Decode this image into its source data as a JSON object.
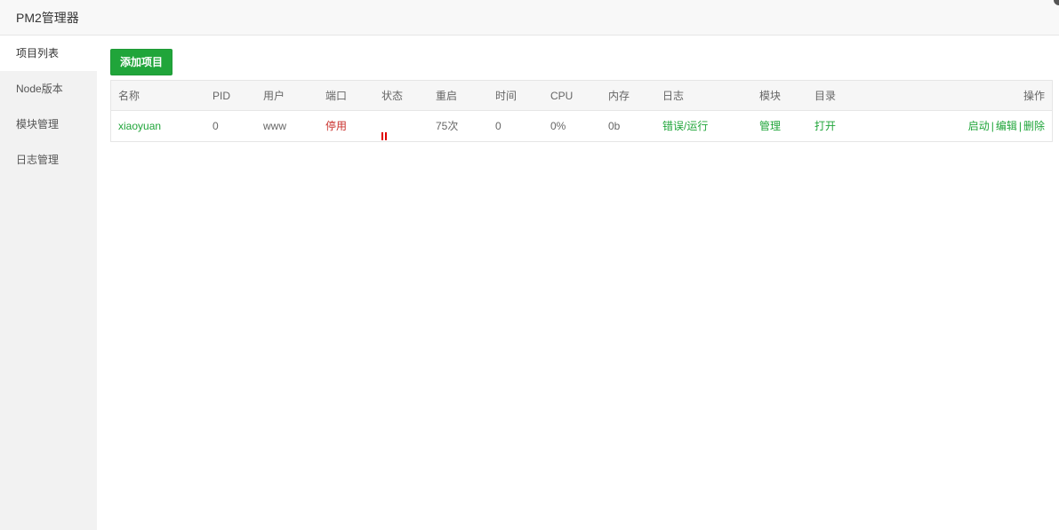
{
  "window": {
    "title": "PM2管理器"
  },
  "sidebar": {
    "items": [
      {
        "label": "项目列表",
        "active": true
      },
      {
        "label": "Node版本",
        "active": false
      },
      {
        "label": "模块管理",
        "active": false
      },
      {
        "label": "日志管理",
        "active": false
      }
    ]
  },
  "toolbar": {
    "add_label": "添加项目"
  },
  "table": {
    "headers": {
      "name": "名称",
      "pid": "PID",
      "user": "用户",
      "port": "端口",
      "status": "状态",
      "restart": "重启",
      "time": "时间",
      "cpu": "CPU",
      "memory": "内存",
      "log": "日志",
      "module": "模块",
      "dir": "目录",
      "actions": "操作"
    },
    "rows": [
      {
        "name": "xiaoyuan",
        "pid": "0",
        "user": "www",
        "port": "停用",
        "status_icon": "pause-icon",
        "restart": "75次",
        "time": "0",
        "cpu": "0%",
        "memory": "0b",
        "log": "错误/运行",
        "module": "管理",
        "dir": "打开",
        "action_start": "启动",
        "action_edit": "编辑",
        "action_delete": "删除",
        "action_sep": "|"
      }
    ]
  },
  "colors": {
    "accent": "#20a53a",
    "danger": "#c9302c",
    "status_paused": "#e00000"
  }
}
